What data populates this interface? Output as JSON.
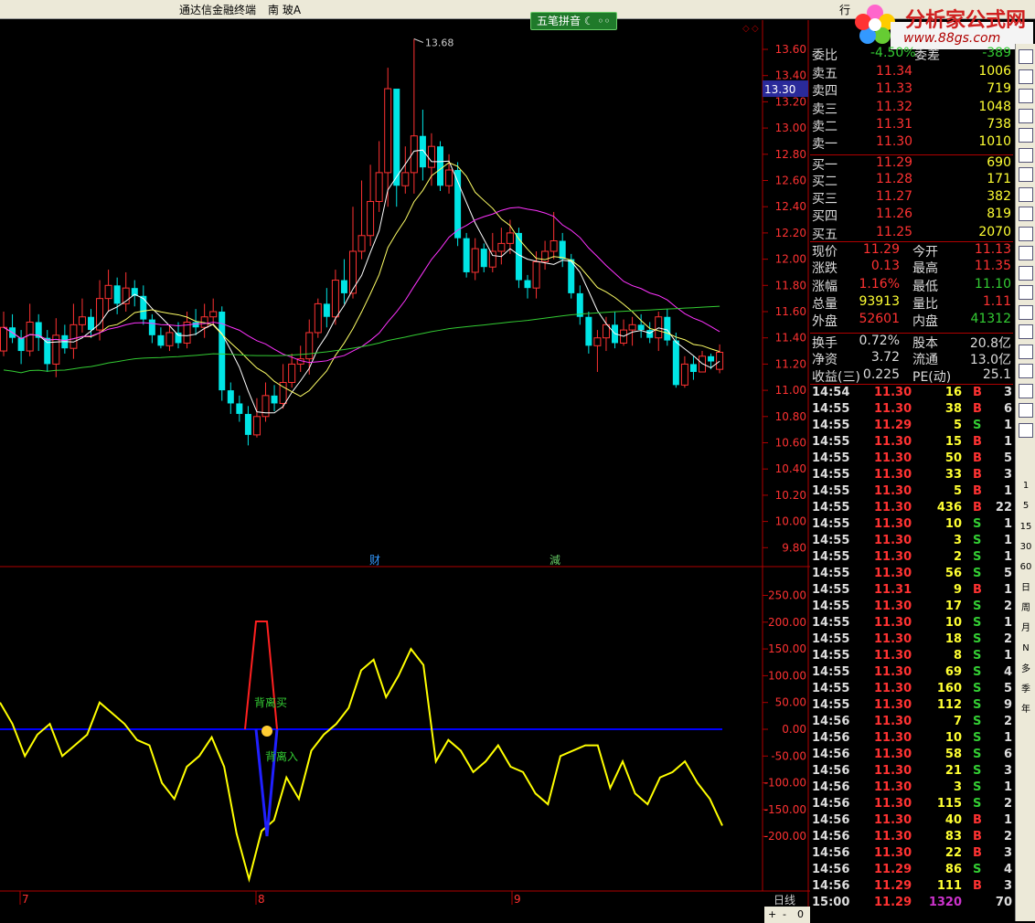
{
  "window": {
    "title": "通达信金融终端",
    "stock_name": "南 玻A",
    "right_label": "行"
  },
  "pinyin_button": "五笔拼音",
  "watermark": {
    "brand": "分析家公式网",
    "url": "www.88gs.com"
  },
  "price_axis": [
    "13.60",
    "13.40",
    "13.20",
    "13.00",
    "12.80",
    "12.60",
    "12.40",
    "12.20",
    "12.00",
    "11.80",
    "11.60",
    "11.40",
    "11.20",
    "11.00",
    "10.80",
    "10.60",
    "10.40",
    "10.20",
    "10.00",
    "9.80"
  ],
  "current_price_tag": "13.30",
  "high_marker": "13.68",
  "event_markers": [
    "财",
    "減"
  ],
  "indicator_axis": [
    "250.00",
    "200.00",
    "150.00",
    "100.00",
    "50.00",
    "0.00",
    "-50.00",
    "-100.00",
    "-150.00",
    "-200.00"
  ],
  "indicator_labels": {
    "buy": "背离买",
    "enter": "背离入"
  },
  "date_labels": [
    "7",
    "8",
    "9"
  ],
  "period_label": "日线",
  "zoom_controls": [
    "+",
    "-",
    "0"
  ],
  "colors": {
    "up": "#ff3232",
    "down": "#00e5e5",
    "ma5": "#ffffff",
    "ma10": "#ffff66",
    "ma20": "#ff33ff",
    "ma60": "#33cc33",
    "indicator": "#ffff00",
    "zero": "#0000ff"
  },
  "chart_data": {
    "type": "candlestick",
    "candles": [
      [
        11.3,
        11.48,
        11.6,
        11.26
      ],
      [
        11.48,
        11.4,
        11.58,
        11.36
      ],
      [
        11.4,
        11.3,
        11.46,
        11.2
      ],
      [
        11.3,
        11.52,
        11.66,
        11.26
      ],
      [
        11.52,
        11.4,
        11.58,
        11.3
      ],
      [
        11.4,
        11.2,
        11.46,
        11.14
      ],
      [
        11.2,
        11.42,
        11.55,
        11.1
      ],
      [
        11.42,
        11.32,
        11.5,
        11.28
      ],
      [
        11.32,
        11.5,
        11.66,
        11.24
      ],
      [
        11.5,
        11.56,
        11.7,
        11.44
      ],
      [
        11.56,
        11.46,
        11.62,
        11.4
      ],
      [
        11.46,
        11.7,
        11.84,
        11.38
      ],
      [
        11.7,
        11.8,
        11.92,
        11.6
      ],
      [
        11.8,
        11.66,
        11.86,
        11.58
      ],
      [
        11.66,
        11.78,
        11.9,
        11.6
      ],
      [
        11.78,
        11.72,
        11.84,
        11.64
      ],
      [
        11.72,
        11.54,
        11.8,
        11.5
      ],
      [
        11.54,
        11.42,
        11.58,
        11.36
      ],
      [
        11.42,
        11.34,
        11.48,
        11.32
      ],
      [
        11.34,
        11.44,
        11.5,
        11.3
      ],
      [
        11.44,
        11.36,
        11.52,
        11.32
      ],
      [
        11.36,
        11.52,
        11.6,
        11.32
      ],
      [
        11.52,
        11.48,
        11.62,
        11.42
      ],
      [
        11.48,
        11.56,
        11.66,
        11.4
      ],
      [
        11.56,
        11.6,
        11.7,
        11.5
      ],
      [
        11.6,
        11.0,
        11.64,
        10.92
      ],
      [
        11.0,
        10.9,
        11.06,
        10.82
      ],
      [
        10.9,
        10.82,
        10.96,
        10.76
      ],
      [
        10.82,
        10.66,
        10.88,
        10.58
      ],
      [
        10.66,
        10.8,
        10.94,
        10.64
      ],
      [
        10.8,
        10.96,
        11.06,
        10.76
      ],
      [
        10.96,
        10.9,
        11.04,
        10.84
      ],
      [
        10.9,
        11.06,
        11.2,
        10.86
      ],
      [
        11.06,
        11.2,
        11.28,
        11.02
      ],
      [
        11.2,
        11.24,
        11.34,
        11.14
      ],
      [
        11.24,
        11.44,
        11.54,
        11.12
      ],
      [
        11.44,
        11.66,
        11.7,
        11.4
      ],
      [
        11.66,
        11.56,
        11.78,
        11.48
      ],
      [
        11.56,
        11.84,
        11.92,
        11.5
      ],
      [
        11.84,
        11.74,
        12.0,
        11.66
      ],
      [
        11.74,
        12.06,
        12.4,
        11.7
      ],
      [
        12.06,
        12.18,
        12.6,
        12.0
      ],
      [
        12.18,
        12.44,
        12.72,
        12.1
      ],
      [
        12.44,
        12.66,
        12.9,
        12.36
      ],
      [
        12.66,
        13.3,
        13.46,
        12.4
      ],
      [
        13.3,
        12.56,
        12.64,
        12.4
      ],
      [
        12.56,
        12.66,
        12.86,
        12.5
      ],
      [
        12.66,
        12.94,
        13.68,
        12.5
      ],
      [
        12.94,
        12.7,
        13.14,
        12.6
      ],
      [
        12.7,
        12.86,
        12.96,
        12.56
      ],
      [
        12.86,
        12.56,
        12.9,
        12.52
      ],
      [
        12.56,
        12.68,
        12.8,
        12.5
      ],
      [
        12.68,
        12.16,
        12.74,
        12.1
      ],
      [
        12.16,
        11.9,
        12.2,
        11.86
      ],
      [
        11.9,
        12.08,
        12.16,
        11.84
      ],
      [
        12.08,
        11.94,
        12.12,
        11.9
      ],
      [
        11.94,
        12.06,
        12.2,
        11.9
      ],
      [
        12.06,
        12.12,
        12.24,
        11.96
      ],
      [
        12.12,
        12.2,
        12.3,
        12.04
      ],
      [
        12.2,
        11.84,
        12.24,
        11.78
      ],
      [
        11.84,
        11.78,
        11.88,
        11.7
      ],
      [
        11.78,
        11.98,
        12.06,
        11.7
      ],
      [
        11.98,
        12.06,
        12.14,
        11.92
      ],
      [
        12.06,
        12.14,
        12.36,
        12.0
      ],
      [
        12.14,
        12.0,
        12.2,
        11.94
      ],
      [
        12.0,
        11.74,
        12.04,
        11.7
      ],
      [
        11.74,
        11.56,
        11.8,
        11.5
      ],
      [
        11.56,
        11.34,
        11.6,
        11.28
      ],
      [
        11.34,
        11.4,
        11.46,
        11.14
      ],
      [
        11.4,
        11.5,
        11.56,
        11.3
      ],
      [
        11.5,
        11.36,
        11.6,
        11.32
      ],
      [
        11.36,
        11.46,
        11.54,
        11.34
      ],
      [
        11.46,
        11.5,
        11.56,
        11.34
      ],
      [
        11.5,
        11.46,
        11.58,
        11.4
      ],
      [
        11.46,
        11.4,
        11.52,
        11.36
      ],
      [
        11.4,
        11.56,
        11.6,
        11.3
      ],
      [
        11.56,
        11.38,
        11.62,
        11.34
      ],
      [
        11.38,
        11.04,
        11.44,
        11.02
      ],
      [
        11.04,
        11.2,
        11.26,
        11.02
      ],
      [
        11.2,
        11.14,
        11.26,
        11.08
      ],
      [
        11.14,
        11.26,
        11.3,
        11.16
      ],
      [
        11.26,
        11.22,
        11.28,
        11.16
      ],
      [
        11.16,
        11.29,
        11.35,
        11.13
      ]
    ],
    "indicator": [
      50,
      10,
      -50,
      -10,
      10,
      -50,
      -30,
      -10,
      50,
      30,
      10,
      -20,
      -30,
      -100,
      -130,
      -70,
      -50,
      -15,
      -70,
      -195,
      -280,
      -190,
      -170,
      -90,
      -130,
      -40,
      -10,
      10,
      40,
      110,
      130,
      60,
      100,
      150,
      120,
      -60,
      -20,
      -40,
      -80,
      -60,
      -30,
      -70,
      -80,
      -120,
      -140,
      -50,
      -40,
      -30,
      -30,
      -110,
      -60,
      -120,
      -140,
      -90,
      -80,
      -60,
      -100,
      -130,
      -180
    ]
  },
  "quote": {
    "rows1": [
      {
        "label": "委比",
        "val": "-4.50%",
        "label2": "委差",
        "val2": "-389"
      },
      {
        "label": "卖五",
        "val": "11.34",
        "vol": "1006"
      },
      {
        "label": "卖四",
        "val": "11.33",
        "vol": "719"
      },
      {
        "label": "卖三",
        "val": "11.32",
        "vol": "1048"
      },
      {
        "label": "卖二",
        "val": "11.31",
        "vol": "738"
      },
      {
        "label": "卖一",
        "val": "11.30",
        "vol": "1010"
      },
      {
        "label": "买一",
        "val": "11.29",
        "vol": "690"
      },
      {
        "label": "买二",
        "val": "11.28",
        "vol": "171"
      },
      {
        "label": "买三",
        "val": "11.27",
        "vol": "382"
      },
      {
        "label": "买四",
        "val": "11.26",
        "vol": "819"
      },
      {
        "label": "买五",
        "val": "11.25",
        "vol": "2070"
      }
    ],
    "rows2": [
      {
        "label": "现价",
        "val": "11.29",
        "label2": "今开",
        "val2": "11.13"
      },
      {
        "label": "涨跌",
        "val": "0.13",
        "label2": "最高",
        "val2": "11.35"
      },
      {
        "label": "涨幅",
        "val": "1.16%",
        "label2": "最低",
        "val2": "11.10"
      },
      {
        "label": "总量",
        "val": "93913",
        "label2": "量比",
        "val2": "1.11"
      },
      {
        "label": "外盘",
        "val": "52601",
        "label2": "内盘",
        "val2": "41312"
      },
      {
        "label": "换手",
        "val": "0.72%",
        "label2": "股本",
        "val2": "20.8亿"
      },
      {
        "label": "净资",
        "val": "3.72",
        "label2": "流通",
        "val2": "13.0亿"
      },
      {
        "label": "收益(三)",
        "val": "0.225",
        "label2": "PE(动)",
        "val2": "25.1"
      }
    ]
  },
  "ticks": [
    [
      "14:54",
      "11.30",
      "16",
      "B",
      "3"
    ],
    [
      "14:55",
      "11.30",
      "38",
      "B",
      "6"
    ],
    [
      "14:55",
      "11.29",
      "5",
      "S",
      "1"
    ],
    [
      "14:55",
      "11.30",
      "15",
      "B",
      "1"
    ],
    [
      "14:55",
      "11.30",
      "50",
      "B",
      "5"
    ],
    [
      "14:55",
      "11.30",
      "33",
      "B",
      "3"
    ],
    [
      "14:55",
      "11.30",
      "5",
      "B",
      "1"
    ],
    [
      "14:55",
      "11.30",
      "436",
      "B",
      "22"
    ],
    [
      "14:55",
      "11.30",
      "10",
      "S",
      "1"
    ],
    [
      "14:55",
      "11.30",
      "3",
      "S",
      "1"
    ],
    [
      "14:55",
      "11.30",
      "2",
      "S",
      "1"
    ],
    [
      "14:55",
      "11.30",
      "56",
      "S",
      "5"
    ],
    [
      "14:55",
      "11.31",
      "9",
      "B",
      "1"
    ],
    [
      "14:55",
      "11.30",
      "17",
      "S",
      "2"
    ],
    [
      "14:55",
      "11.30",
      "10",
      "S",
      "1"
    ],
    [
      "14:55",
      "11.30",
      "18",
      "S",
      "2"
    ],
    [
      "14:55",
      "11.30",
      "8",
      "S",
      "1"
    ],
    [
      "14:55",
      "11.30",
      "69",
      "S",
      "4"
    ],
    [
      "14:55",
      "11.30",
      "160",
      "S",
      "5"
    ],
    [
      "14:55",
      "11.30",
      "112",
      "S",
      "9"
    ],
    [
      "14:56",
      "11.30",
      "7",
      "S",
      "2"
    ],
    [
      "14:56",
      "11.30",
      "10",
      "S",
      "1"
    ],
    [
      "14:56",
      "11.30",
      "58",
      "S",
      "6"
    ],
    [
      "14:56",
      "11.30",
      "21",
      "S",
      "3"
    ],
    [
      "14:56",
      "11.30",
      "3",
      "S",
      "1"
    ],
    [
      "14:56",
      "11.30",
      "115",
      "S",
      "2"
    ],
    [
      "14:56",
      "11.30",
      "40",
      "B",
      "1"
    ],
    [
      "14:56",
      "11.30",
      "83",
      "B",
      "2"
    ],
    [
      "14:56",
      "11.30",
      "22",
      "B",
      "3"
    ],
    [
      "14:56",
      "11.29",
      "86",
      "S",
      "4"
    ],
    [
      "14:56",
      "11.29",
      "111",
      "B",
      "3"
    ],
    [
      "15:00",
      "11.29",
      "1320",
      "",
      "70"
    ]
  ],
  "toolbar_items": [
    "1",
    "5",
    "15",
    "30",
    "60",
    "日",
    "周",
    "月",
    "N",
    "多",
    "季",
    "年"
  ]
}
